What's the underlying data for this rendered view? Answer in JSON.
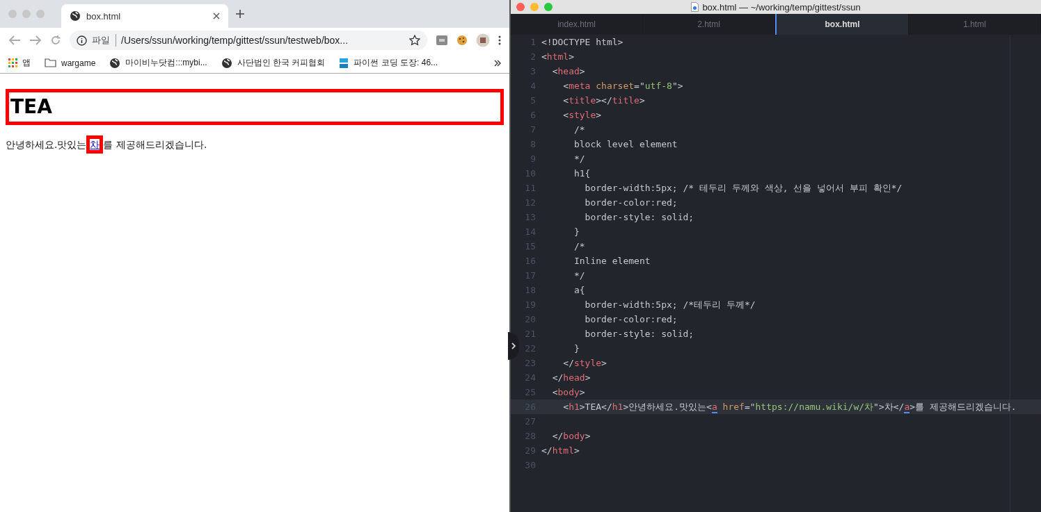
{
  "browser": {
    "tabs": [
      {
        "title": "box.html",
        "selected": true
      }
    ],
    "address_bar": {
      "scheme_label": "파일",
      "url": "/Users/ssun/working/temp/gittest/ssun/testweb/box..."
    },
    "bookmarks": [
      {
        "kind": "apps",
        "label": "앱"
      },
      {
        "kind": "folder",
        "label": "wargame"
      },
      {
        "kind": "globe",
        "label": "마이비누닷컴:::mybi..."
      },
      {
        "kind": "globe",
        "label": "사단법인 한국 커피협회"
      },
      {
        "kind": "site",
        "label": "파이썬 코딩 도장: 46..."
      }
    ],
    "page": {
      "heading": "TEA",
      "text_before": "안녕하세요.맛있는",
      "link": "차",
      "text_after": "를 제공해드리겠습니다."
    }
  },
  "editor": {
    "title": "box.html — ~/working/temp/gittest/ssun",
    "tabs": [
      {
        "label": "index.html",
        "selected": false
      },
      {
        "label": "2.html",
        "selected": false
      },
      {
        "label": "box.html",
        "selected": true
      },
      {
        "label": "1.html",
        "selected": false
      }
    ],
    "lines": [
      {
        "n": "1",
        "current": false,
        "tokens": [
          {
            "kind": "plain",
            "t": "<!DOCTYPE html>"
          }
        ]
      },
      {
        "n": "2",
        "current": false,
        "tokens": [
          {
            "kind": "plain",
            "t": "<"
          },
          {
            "kind": "tag",
            "t": "html"
          },
          {
            "kind": "plain",
            "t": ">"
          }
        ]
      },
      {
        "n": "3",
        "current": false,
        "tokens": [
          {
            "kind": "plain",
            "t": "  <"
          },
          {
            "kind": "tag",
            "t": "head"
          },
          {
            "kind": "plain",
            "t": ">"
          }
        ]
      },
      {
        "n": "4",
        "current": false,
        "tokens": [
          {
            "kind": "plain",
            "t": "    <"
          },
          {
            "kind": "tag",
            "t": "meta"
          },
          {
            "kind": "attr",
            "t": " charset"
          },
          {
            "kind": "plain",
            "t": "=\""
          },
          {
            "kind": "string",
            "t": "utf-8"
          },
          {
            "kind": "plain",
            "t": "\">"
          }
        ]
      },
      {
        "n": "5",
        "current": false,
        "tokens": [
          {
            "kind": "plain",
            "t": "    <"
          },
          {
            "kind": "tag",
            "t": "title"
          },
          {
            "kind": "plain",
            "t": "></"
          },
          {
            "kind": "tag",
            "t": "title"
          },
          {
            "kind": "plain",
            "t": ">"
          }
        ]
      },
      {
        "n": "6",
        "current": false,
        "tokens": [
          {
            "kind": "plain",
            "t": "    <"
          },
          {
            "kind": "tag",
            "t": "style"
          },
          {
            "kind": "plain",
            "t": ">"
          }
        ]
      },
      {
        "n": "7",
        "current": false,
        "tokens": [
          {
            "kind": "plain",
            "t": "      /*"
          }
        ]
      },
      {
        "n": "8",
        "current": false,
        "tokens": [
          {
            "kind": "plain",
            "t": "      block level element"
          }
        ]
      },
      {
        "n": "9",
        "current": false,
        "tokens": [
          {
            "kind": "plain",
            "t": "      */"
          }
        ]
      },
      {
        "n": "10",
        "current": false,
        "tokens": [
          {
            "kind": "plain",
            "t": "      h1{"
          }
        ]
      },
      {
        "n": "11",
        "current": false,
        "tokens": [
          {
            "kind": "plain",
            "t": "        border-width:5px; /* 테두리 두께와 색상, 선을 넣어서 부피 확인*/"
          }
        ]
      },
      {
        "n": "12",
        "current": false,
        "tokens": [
          {
            "kind": "plain",
            "t": "        border-color:red;"
          }
        ]
      },
      {
        "n": "13",
        "current": false,
        "tokens": [
          {
            "kind": "plain",
            "t": "        border-style: solid;"
          }
        ]
      },
      {
        "n": "14",
        "current": false,
        "tokens": [
          {
            "kind": "plain",
            "t": "      }"
          }
        ]
      },
      {
        "n": "15",
        "current": false,
        "tokens": [
          {
            "kind": "plain",
            "t": "      /*"
          }
        ]
      },
      {
        "n": "16",
        "current": false,
        "tokens": [
          {
            "kind": "plain",
            "t": "      Inline element"
          }
        ]
      },
      {
        "n": "17",
        "current": false,
        "tokens": [
          {
            "kind": "plain",
            "t": "      */"
          }
        ]
      },
      {
        "n": "18",
        "current": false,
        "tokens": [
          {
            "kind": "plain",
            "t": "      a{"
          }
        ]
      },
      {
        "n": "19",
        "current": false,
        "tokens": [
          {
            "kind": "plain",
            "t": "        border-width:5px; /*테두리 두께*/"
          }
        ]
      },
      {
        "n": "20",
        "current": false,
        "tokens": [
          {
            "kind": "plain",
            "t": "        border-color:red;"
          }
        ]
      },
      {
        "n": "21",
        "current": false,
        "tokens": [
          {
            "kind": "plain",
            "t": "        border-style: solid;"
          }
        ]
      },
      {
        "n": "22",
        "current": false,
        "tokens": [
          {
            "kind": "plain",
            "t": "      }"
          }
        ]
      },
      {
        "n": "23",
        "current": false,
        "tokens": [
          {
            "kind": "plain",
            "t": "    </"
          },
          {
            "kind": "tag",
            "t": "style"
          },
          {
            "kind": "plain",
            "t": ">"
          }
        ]
      },
      {
        "n": "24",
        "current": false,
        "tokens": [
          {
            "kind": "plain",
            "t": "  </"
          },
          {
            "kind": "tag",
            "t": "head"
          },
          {
            "kind": "plain",
            "t": ">"
          }
        ]
      },
      {
        "n": "25",
        "current": false,
        "tokens": [
          {
            "kind": "plain",
            "t": "  <"
          },
          {
            "kind": "tag",
            "t": "body"
          },
          {
            "kind": "plain",
            "t": ">"
          }
        ]
      },
      {
        "n": "26",
        "current": true,
        "tokens": [
          {
            "kind": "plain",
            "t": "    <"
          },
          {
            "kind": "tag",
            "t": "h1"
          },
          {
            "kind": "plain",
            "t": ">TEA</"
          },
          {
            "kind": "tag",
            "t": "h1"
          },
          {
            "kind": "plain",
            "t": ">안녕하세요.맛있는<"
          },
          {
            "kind": "match",
            "t": "a"
          },
          {
            "kind": "attr",
            "t": " href"
          },
          {
            "kind": "plain",
            "t": "=\""
          },
          {
            "kind": "string",
            "t": "https://namu.wiki/w/차"
          },
          {
            "kind": "plain",
            "t": "\">차</"
          },
          {
            "kind": "match",
            "t": "a"
          },
          {
            "kind": "plain",
            "t": ">를 제공해드리겠습니다."
          }
        ]
      },
      {
        "n": "27",
        "current": false
      },
      {
        "n": "28",
        "current": false,
        "tokens": [
          {
            "kind": "plain",
            "t": "  </"
          },
          {
            "kind": "tag",
            "t": "body"
          },
          {
            "kind": "plain",
            "t": ">"
          }
        ]
      },
      {
        "n": "29",
        "current": false,
        "tokens": [
          {
            "kind": "plain",
            "t": "</"
          },
          {
            "kind": "tag",
            "t": "html"
          },
          {
            "kind": "plain",
            "t": ">"
          }
        ]
      },
      {
        "n": "30",
        "current": false
      }
    ]
  }
}
